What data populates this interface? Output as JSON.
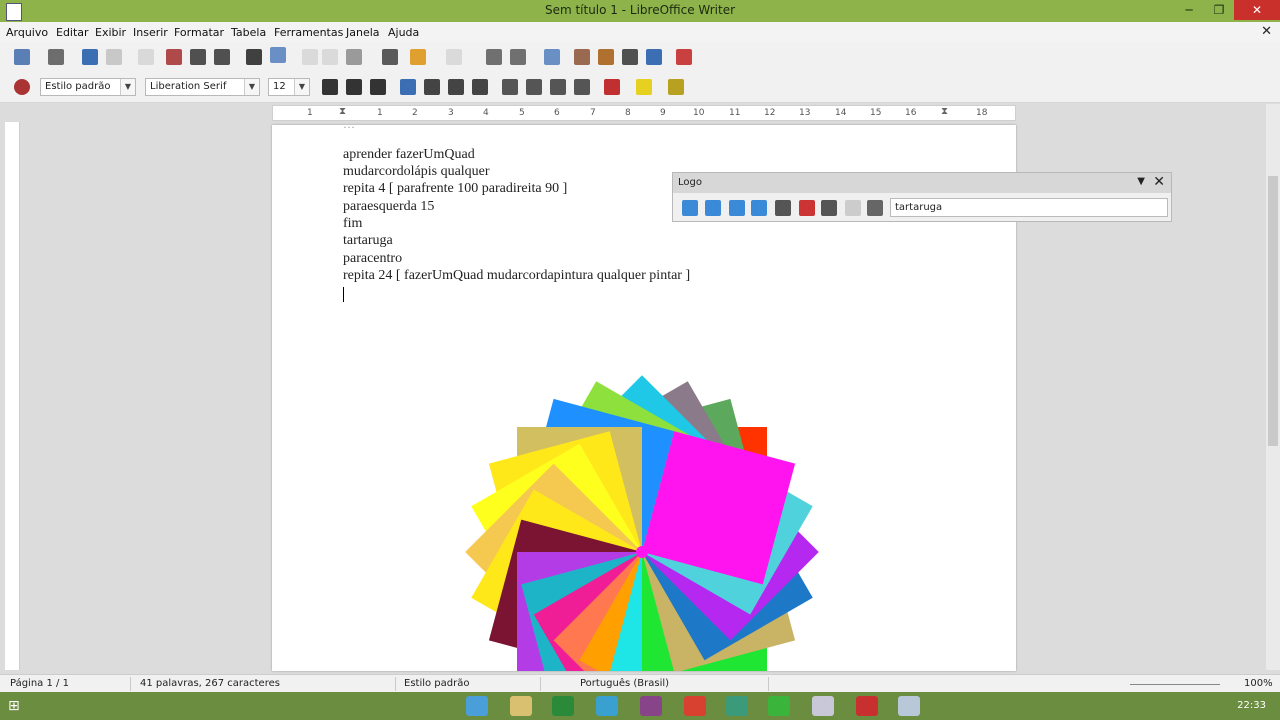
{
  "window": {
    "title": "Sem título 1 - LibreOffice Writer"
  },
  "menu": [
    "Arquivo",
    "Editar",
    "Exibir",
    "Inserir",
    "Formatar",
    "Tabela",
    "Ferramentas",
    "Janela",
    "Ajuda"
  ],
  "formatting": {
    "style": "Estilo padrão",
    "font": "Liberation Serif",
    "size": "12"
  },
  "ruler": [
    "1",
    "1",
    "2",
    "3",
    "4",
    "5",
    "6",
    "7",
    "8",
    "9",
    "10",
    "11",
    "12",
    "13",
    "14",
    "15",
    "16",
    "18"
  ],
  "document": {
    "lines": [
      "aprender fazerUmQuad",
      "mudarcordolápis qualquer",
      "repita 4 [ parafrente 100 paradireita 90 ]",
      "paraesquerda 15",
      "fim",
      "tartaruga",
      "paracentro",
      "repita 24 [ fazerUmQuad mudarcordapintura qualquer pintar ]"
    ]
  },
  "logo_toolbar": {
    "title": "Logo",
    "command": "tartaruga"
  },
  "status": {
    "page": "Página 1 / 1",
    "words": "41 palavras, 267 caracteres",
    "style": "Estilo padrão",
    "language": "Português (Brasil)",
    "zoom": "100%"
  },
  "taskbar": {
    "clock": "22:33"
  },
  "drawing": {
    "squares": [
      {
        "angle": 0,
        "color": "#ff3300"
      },
      {
        "angle": 15,
        "color": "#5ca85c"
      },
      {
        "angle": 30,
        "color": "#8a7a8a"
      },
      {
        "angle": 45,
        "color": "#1ec8e6"
      },
      {
        "angle": 60,
        "color": "#8ee03c"
      },
      {
        "angle": 75,
        "color": "#1e90ff"
      },
      {
        "angle": 90,
        "color": "#d2c060"
      },
      {
        "angle": 105,
        "color": "#ffe81a"
      },
      {
        "angle": 120,
        "color": "#ffff1e"
      },
      {
        "angle": 135,
        "color": "#f5c850"
      },
      {
        "angle": 150,
        "color": "#ffe81a"
      },
      {
        "angle": 165,
        "color": "#7a1432"
      },
      {
        "angle": 180,
        "color": "#b43ce6"
      },
      {
        "angle": 195,
        "color": "#1eb4c8"
      },
      {
        "angle": 210,
        "color": "#f01e96"
      },
      {
        "angle": 225,
        "color": "#ff7850"
      },
      {
        "angle": 240,
        "color": "#ffa000"
      },
      {
        "angle": 255,
        "color": "#1ee6e6"
      },
      {
        "angle": 270,
        "color": "#1ee632"
      },
      {
        "angle": 285,
        "color": "#c8b464"
      },
      {
        "angle": 300,
        "color": "#1e78c8"
      },
      {
        "angle": 315,
        "color": "#b428f0"
      },
      {
        "angle": 330,
        "color": "#50d2dc"
      },
      {
        "angle": 345,
        "color": "#ff14f0"
      }
    ]
  }
}
